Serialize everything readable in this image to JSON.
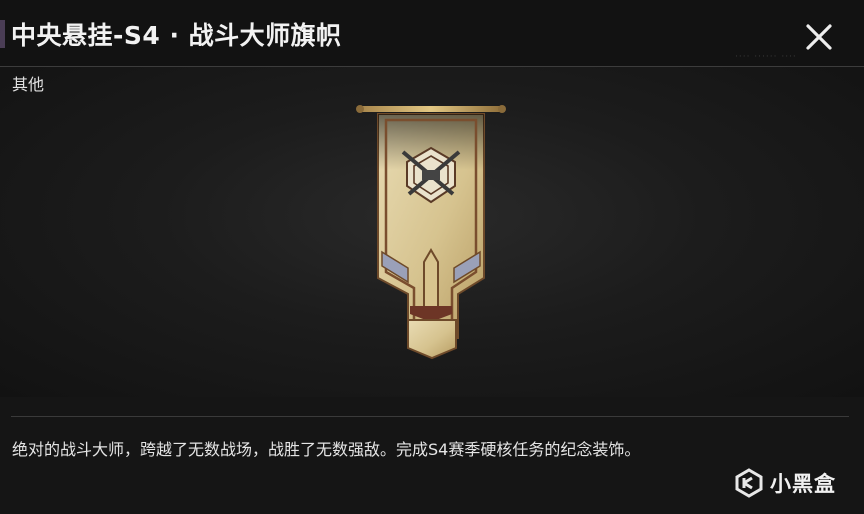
{
  "header": {
    "title": "中央悬挂-S4 · 战斗大师旗帜",
    "close_icon": "close-icon",
    "accent_color": "#4a3d55"
  },
  "item": {
    "category": "其他",
    "image_icon": "banner-flag-crossed-rifles-emblem",
    "description": "绝对的战斗大师，跨越了无数战场，战胜了无数强敌。完成S4赛季硬核任务的纪念装饰。"
  },
  "watermark": {
    "logo_icon": "xiaoheihe-logo-icon",
    "text": "小黑盒"
  }
}
